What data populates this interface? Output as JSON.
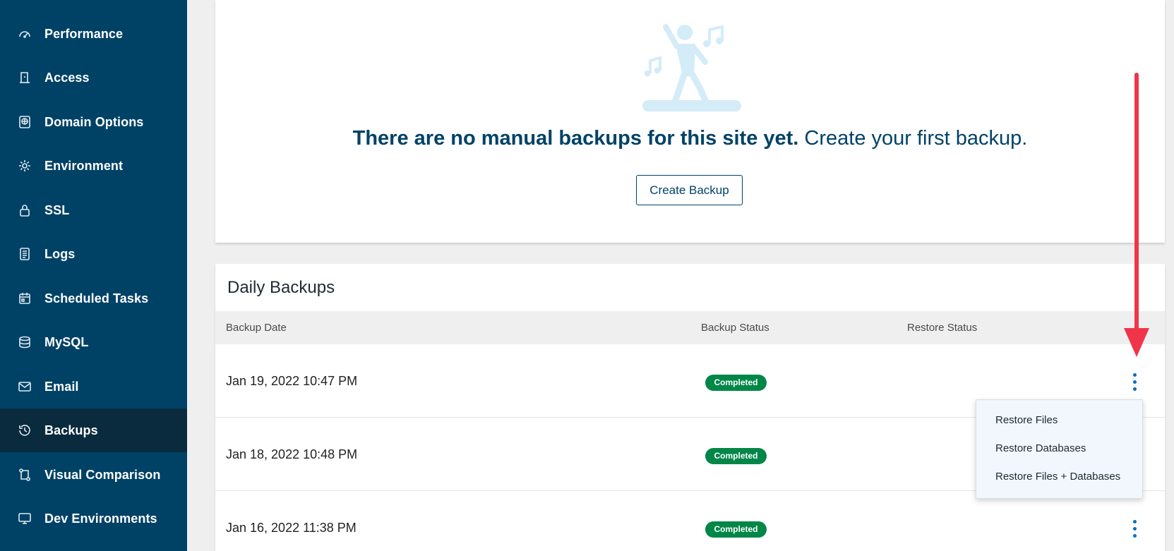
{
  "sidebar": {
    "items": [
      {
        "label": "Performance",
        "icon": "gauge-icon",
        "active": false
      },
      {
        "label": "Access",
        "icon": "door-icon",
        "active": false
      },
      {
        "label": "Domain Options",
        "icon": "globe-icon",
        "active": false
      },
      {
        "label": "Environment",
        "icon": "gear-icon",
        "active": false
      },
      {
        "label": "SSL",
        "icon": "lock-icon",
        "active": false
      },
      {
        "label": "Logs",
        "icon": "document-icon",
        "active": false
      },
      {
        "label": "Scheduled Tasks",
        "icon": "calendar-icon",
        "active": false
      },
      {
        "label": "MySQL",
        "icon": "database-icon",
        "active": false
      },
      {
        "label": "Email",
        "icon": "envelope-icon",
        "active": false
      },
      {
        "label": "Backups",
        "icon": "history-icon",
        "active": true
      },
      {
        "label": "Visual Comparison",
        "icon": "compare-icon",
        "active": false
      },
      {
        "label": "Dev Environments",
        "icon": "monitor-icon",
        "active": false
      }
    ]
  },
  "manual_backups": {
    "empty_bold": "There are no manual backups for this site yet.",
    "empty_regular": " Create your first backup.",
    "create_button": "Create Backup",
    "illustration": "dancing-person-icon"
  },
  "daily_backups": {
    "title": "Daily Backups",
    "columns": {
      "date": "Backup Date",
      "backup_status": "Backup Status",
      "restore_status": "Restore Status"
    },
    "rows": [
      {
        "date": "Jan 19, 2022 10:47 PM",
        "backup_status": "Completed",
        "restore_status": ""
      },
      {
        "date": "Jan 18, 2022 10:48 PM",
        "backup_status": "Completed",
        "restore_status": ""
      },
      {
        "date": "Jan 16, 2022 11:38 PM",
        "backup_status": "Completed",
        "restore_status": ""
      }
    ]
  },
  "row_menu": {
    "items": [
      "Restore Files",
      "Restore Databases",
      "Restore Files + Databases"
    ]
  },
  "colors": {
    "sidebar_bg": "#004266",
    "sidebar_active": "#0a2b3e",
    "brand_text": "#004266",
    "status_completed": "#008748",
    "kebab": "#0a6fb8",
    "annotation_arrow": "#f0344a"
  }
}
